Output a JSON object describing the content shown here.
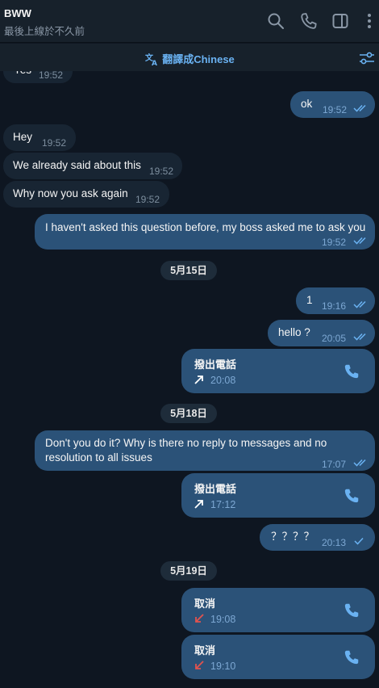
{
  "header": {
    "title": "BWW",
    "status": "最後上線於不久前",
    "icons": [
      "search-icon",
      "phone-icon",
      "sidebar-icon",
      "more-icon"
    ]
  },
  "translate_bar": {
    "label": "翻譯成Chinese",
    "icon": "translate-icon",
    "filter_icon": "sliders-icon"
  },
  "colors": {
    "background": "#0e1621",
    "incoming_bubble": "#182533",
    "outgoing_bubble": "#2b5278",
    "accent": "#6ab2f2",
    "missed_call": "#e2534e"
  },
  "messages": [
    {
      "dir": "in",
      "text": "Yes",
      "time": "19:52"
    },
    {
      "dir": "out",
      "text": "ok",
      "time": "19:52",
      "read": true
    },
    {
      "dir": "in",
      "text": "Hey",
      "time": "19:52"
    },
    {
      "dir": "in",
      "text": "We already said about this",
      "time": "19:52"
    },
    {
      "dir": "in",
      "text": "Why now you ask again",
      "time": "19:52"
    },
    {
      "dir": "out",
      "text": "I haven't asked this question before, my boss asked me to ask you",
      "time": "19:52",
      "read": true
    }
  ],
  "date_15": "5月15日",
  "messages_15": [
    {
      "dir": "out",
      "text": "1",
      "time": "19:16",
      "read": true
    },
    {
      "dir": "out",
      "text": "hello ?",
      "time": "20:05",
      "read": true
    }
  ],
  "call_1": {
    "title": "撥出電話",
    "time": "20:08",
    "kind": "outgoing"
  },
  "date_18": "5月18日",
  "msg_18": {
    "line1": "Don't you do it? Why is there no reply to messages and no",
    "line2": "resolution to all issues",
    "time": "17:07",
    "read": true
  },
  "call_2": {
    "title": "撥出電話",
    "time": "17:12",
    "kind": "outgoing"
  },
  "msg_q": {
    "text": "？？？？",
    "time": "20:13",
    "read": false
  },
  "date_19": "5月19日",
  "call_3": {
    "title": "取消",
    "time": "19:08",
    "kind": "cancelled"
  },
  "call_4": {
    "title": "取消",
    "time": "19:10",
    "kind": "cancelled"
  }
}
